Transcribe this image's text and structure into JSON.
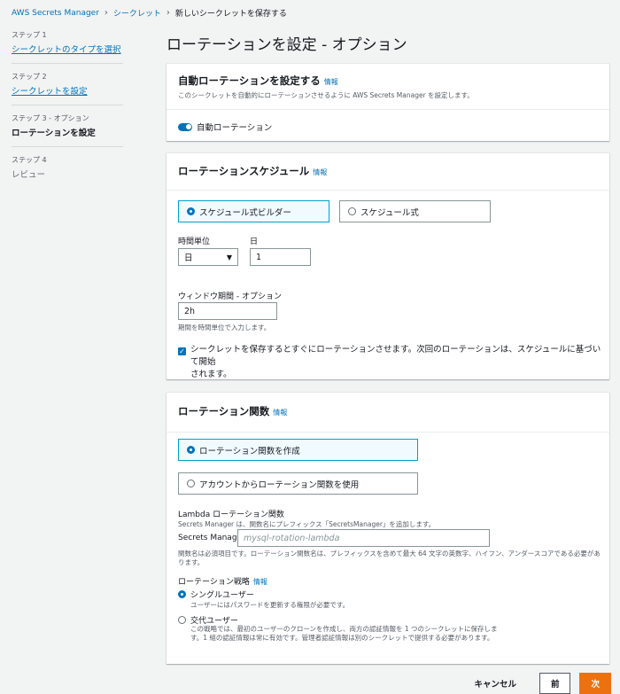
{
  "breadcrumb": {
    "root": "AWS Secrets Manager",
    "secrets": "シークレット",
    "current": "新しいシークレットを保存する"
  },
  "steps": [
    {
      "num": "ステップ 1",
      "label": "シークレットのタイプを選択"
    },
    {
      "num": "ステップ 2",
      "label": "シークレットを設定"
    },
    {
      "num": "ステップ 3 - オプション",
      "label": "ローテーションを設定"
    },
    {
      "num": "ステップ 4",
      "label": "レビュー"
    }
  ],
  "page_title": "ローテーションを設定 - オプション",
  "auto_rotation": {
    "title": "自動ローテーションを設定する",
    "info": "情報",
    "description": "このシークレットを自動的にローテーションさせるように AWS Secrets Manager を設定します。",
    "toggle_label": "自動ローテーション",
    "toggle_on": true
  },
  "schedule": {
    "title": "ローテーションスケジュール",
    "info": "情報",
    "option_builder": "スケジュール式ビルダー",
    "option_expression": "スケジュール式",
    "time_unit_label": "時間単位",
    "time_unit_value": "日",
    "day_label": "日",
    "day_value": "1",
    "window_label": "ウィンドウ期間 - オプション",
    "window_value": "2h",
    "window_hint": "期間を時間単位で入力します。",
    "rotate_immediately_line1": "シークレットを保存するとすぐにローテーションさせます。次回のローテーションは、スケジュールに基づいて開始",
    "rotate_immediately_line2": "されます。",
    "rotate_immediately_checked": true
  },
  "rotation_function": {
    "title": "ローテーション関数",
    "info": "情報",
    "option_create": "ローテーション関数を作成",
    "option_account": "アカウントからローテーション関数を使用",
    "lambda_label": "Lambda ローテーション関数",
    "lambda_hint": "Secrets Manager は、関数名にプレフィックス「SecretsManager」を追加します。",
    "prefix": "Secrets Manager",
    "name_placeholder": "mysql-rotation-lambda",
    "name_hint": "関数名は必須項目です。ローテーション関数名は、プレフィックスを含めて最大 64 文字の英数字、ハイフン、アンダースコアである必要があります。",
    "strategy_label": "ローテーション戦略",
    "strategy_info": "情報",
    "single_user": "シングルユーザー",
    "single_user_hint": "ユーザーにはパスワードを更新する権限が必要です。",
    "alternating_users": "交代ユーザー",
    "alternating_hint": "この戦略では、最初のユーザーのクローンを作成し、両方の認証情報を 1 つのシークレットに保存します。1 組の認証情報は常に有効です。管理者認証情報は別のシークレットで提供する必要があります。"
  },
  "footer": {
    "cancel": "キャンセル",
    "previous": "前",
    "next": "次"
  }
}
